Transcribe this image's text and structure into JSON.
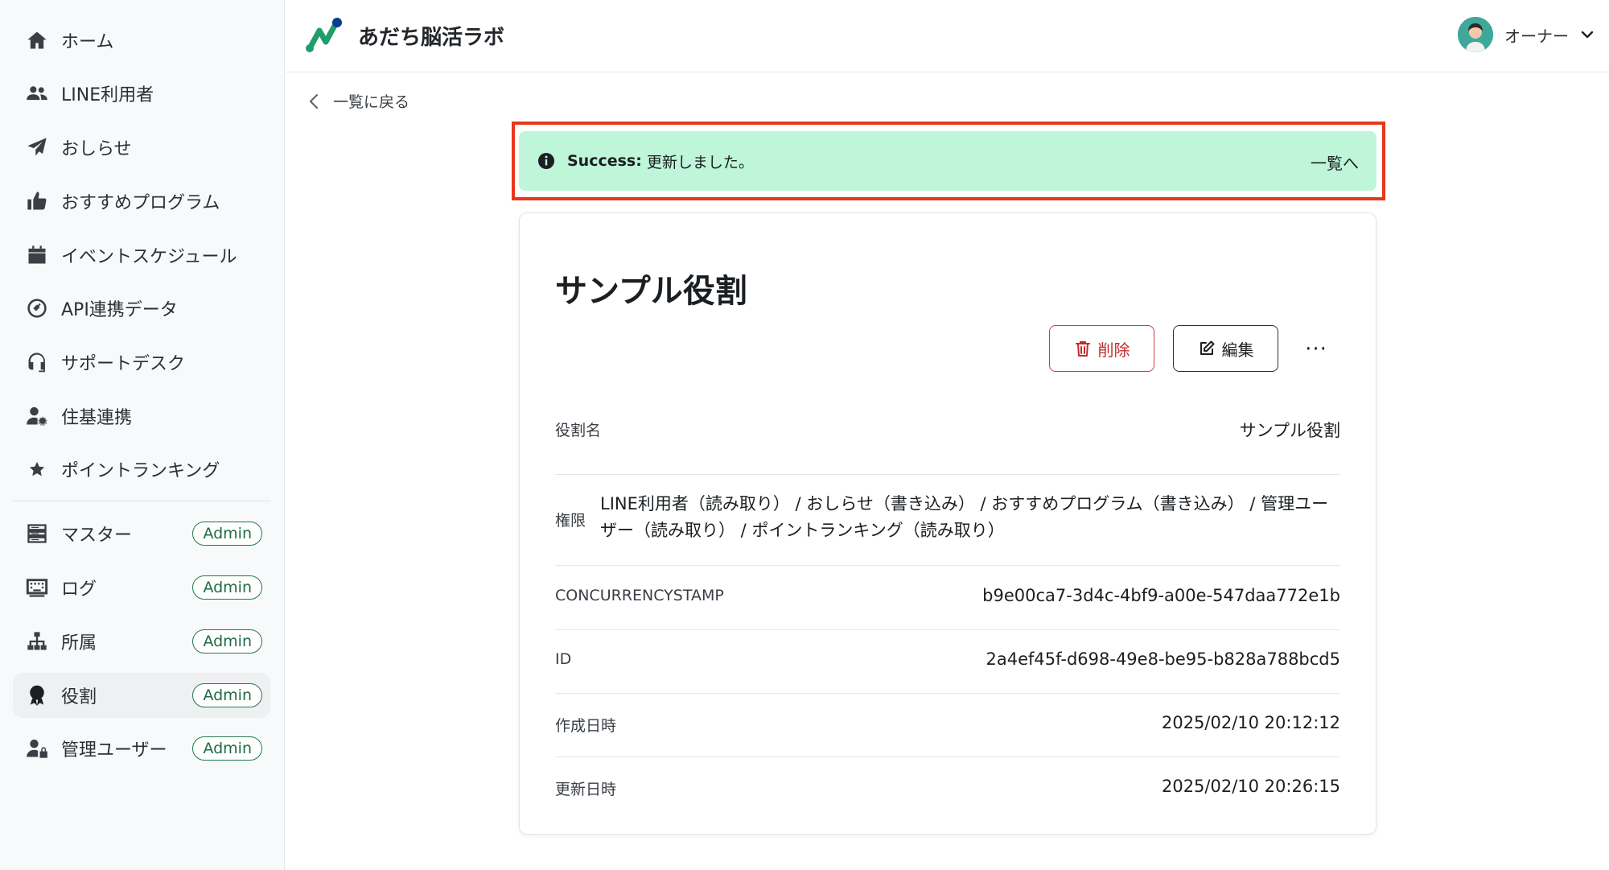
{
  "app": {
    "title": "あだち脳活ラボ",
    "brand_color": "#1e9e6a",
    "accent_color": "#0a3d8c"
  },
  "sidebar": {
    "items": [
      {
        "label": "ホーム",
        "icon": "home-icon"
      },
      {
        "label": "LINE利用者",
        "icon": "users-icon"
      },
      {
        "label": "おしらせ",
        "icon": "paper-plane-icon"
      },
      {
        "label": "おすすめプログラム",
        "icon": "thumbs-up-icon"
      },
      {
        "label": "イベントスケジュール",
        "icon": "calendar-icon"
      },
      {
        "label": "API連携データ",
        "icon": "plug-icon"
      },
      {
        "label": "サポートデスク",
        "icon": "headset-icon"
      },
      {
        "label": "住基連携",
        "icon": "user-gear-icon"
      },
      {
        "label": "ポイントランキング",
        "icon": "star-icon"
      }
    ],
    "admin_items": [
      {
        "label": "マスター",
        "badge": "Admin",
        "icon": "server-icon"
      },
      {
        "label": "ログ",
        "badge": "Admin",
        "icon": "keyboard-icon"
      },
      {
        "label": "所属",
        "badge": "Admin",
        "icon": "sitemap-icon"
      },
      {
        "label": "役割",
        "badge": "Admin",
        "icon": "award-icon",
        "active": true
      },
      {
        "label": "管理ユーザー",
        "badge": "Admin",
        "icon": "user-lock-icon"
      }
    ]
  },
  "header": {
    "user_name": "オーナー"
  },
  "main": {
    "back_label": "一覧に戻る",
    "alert": {
      "strong": "Success:",
      "message": "更新しました。",
      "link": "一覧へ",
      "color": "#bff5d9",
      "highlight_color": "#e8371c"
    },
    "card": {
      "title": "サンプル役割",
      "delete_label": "削除",
      "edit_label": "編集",
      "more_label": "···",
      "fields": {
        "role_name": {
          "label": "役割名",
          "value": "サンプル役割"
        },
        "permissions": {
          "label": "権限",
          "value": "LINE利用者（読み取り） / おしらせ（書き込み） / おすすめプログラム（書き込み） / 管理ユーザー（読み取り） / ポイントランキング（読み取り）"
        },
        "stamp": {
          "label": "CONCURRENCYSTAMP",
          "value": "b9e00ca7-3d4c-4bf9-a00e-547daa772e1b"
        },
        "id": {
          "label": "ID",
          "value": "2a4ef45f-d698-49e8-be95-b828a788bcd5"
        },
        "created": {
          "label": "作成日時",
          "value": "2025/02/10 20:12:12"
        },
        "updated": {
          "label": "更新日時",
          "value": "2025/02/10 20:26:15"
        }
      }
    }
  }
}
